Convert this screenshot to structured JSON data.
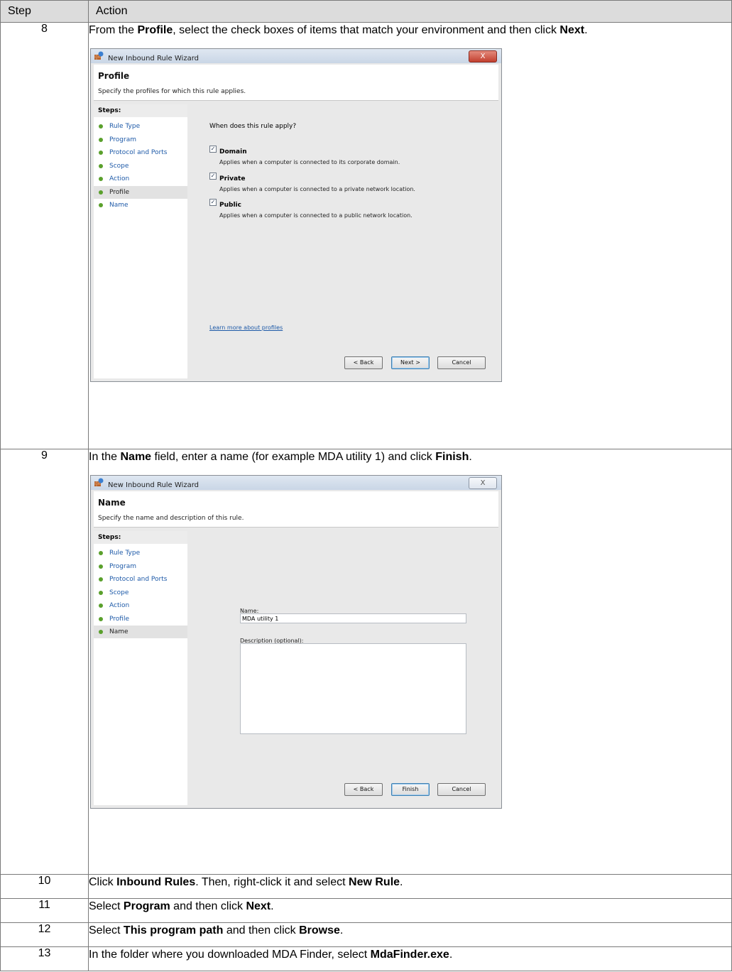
{
  "table": {
    "col_step": "Step",
    "col_action": "Action"
  },
  "rows": [
    {
      "step": "8",
      "parts": [
        {
          "t": "From the "
        },
        {
          "t": "Profile",
          "b": true
        },
        {
          "t": ", select the check boxes of items that match your environment and then click "
        },
        {
          "t": "Next",
          "b": true
        },
        {
          "t": "."
        }
      ]
    },
    {
      "step": "9",
      "parts": [
        {
          "t": "In the "
        },
        {
          "t": "Name",
          "b": true
        },
        {
          "t": " field, enter a name (for example MDA utility 1) and click "
        },
        {
          "t": "Finish",
          "b": true
        },
        {
          "t": "."
        }
      ]
    },
    {
      "step": "10",
      "parts": [
        {
          "t": "Click "
        },
        {
          "t": "Inbound Rules",
          "b": true
        },
        {
          "t": ". Then, right-click it and select "
        },
        {
          "t": "New Rule",
          "b": true
        },
        {
          "t": "."
        }
      ]
    },
    {
      "step": "11",
      "parts": [
        {
          "t": "Select "
        },
        {
          "t": "Program",
          "b": true
        },
        {
          "t": " and then click "
        },
        {
          "t": "Next",
          "b": true
        },
        {
          "t": "."
        }
      ]
    },
    {
      "step": "12",
      "parts": [
        {
          "t": "Select "
        },
        {
          "t": "This program path",
          "b": true
        },
        {
          "t": " and then click "
        },
        {
          "t": "Browse",
          "b": true
        },
        {
          "t": "."
        }
      ]
    },
    {
      "step": "13",
      "parts": [
        {
          "t": "In the folder where you downloaded MDA Finder, select "
        },
        {
          "t": "MdaFinder.exe",
          "b": true
        },
        {
          "t": "."
        }
      ]
    }
  ],
  "wizard1": {
    "title": "New Inbound Rule Wizard",
    "close_label": "X",
    "heading": "Profile",
    "subheading": "Specify the profiles for which this rule applies.",
    "steps_header": "Steps:",
    "steps": [
      "Rule Type",
      "Program",
      "Protocol and Ports",
      "Scope",
      "Action",
      "Profile",
      "Name"
    ],
    "current_step": "Profile",
    "question": "When does this rule apply?",
    "options": [
      {
        "label": "Domain",
        "desc": "Applies when a computer is connected to its corporate domain.",
        "checked": true
      },
      {
        "label": "Private",
        "desc": "Applies when a computer is connected to a private network location.",
        "checked": true
      },
      {
        "label": "Public",
        "desc": "Applies when a computer is connected to a public network location.",
        "checked": true
      }
    ],
    "learn_more": "Learn more about profiles",
    "back_label": "< Back",
    "next_label": "Next >",
    "cancel_label": "Cancel"
  },
  "wizard2": {
    "title": "New Inbound Rule Wizard",
    "close_label": "X",
    "heading": "Name",
    "subheading": "Specify the name and description of this rule.",
    "steps_header": "Steps:",
    "steps": [
      "Rule Type",
      "Program",
      "Protocol and Ports",
      "Scope",
      "Action",
      "Profile",
      "Name"
    ],
    "current_step": "Name",
    "name_label": "Name:",
    "name_value": "MDA utility 1",
    "desc_label": "Description (optional):",
    "desc_value": "",
    "back_label": "< Back",
    "finish_label": "Finish",
    "cancel_label": "Cancel"
  }
}
